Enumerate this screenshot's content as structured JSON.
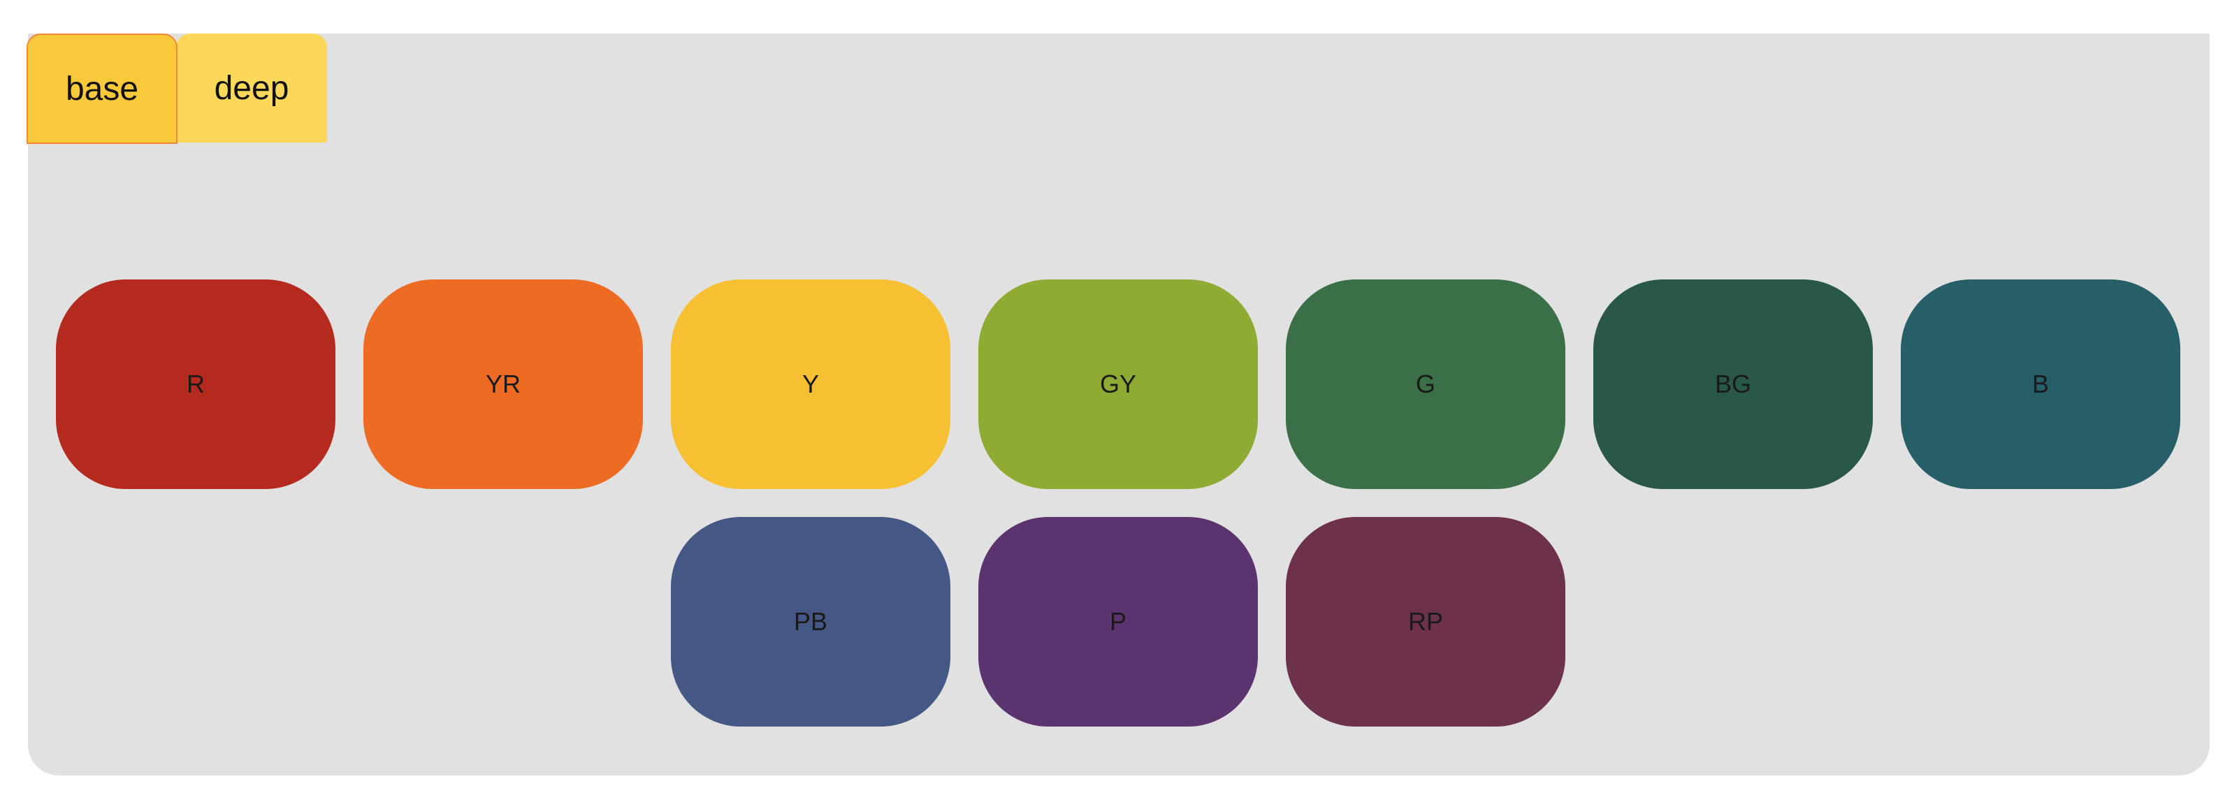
{
  "tabs": [
    {
      "label": "base",
      "selected": true
    },
    {
      "label": "deep",
      "selected": false
    }
  ],
  "swatches": [
    {
      "label": "R",
      "color": "#b52a1f"
    },
    {
      "label": "YR",
      "color": "#ee6b24"
    },
    {
      "label": "Y",
      "color": "#f6c032"
    },
    {
      "label": "GY",
      "color": "#8fab33"
    },
    {
      "label": "G",
      "color": "#3b6f48"
    },
    {
      "label": "BG",
      "color": "#29584a"
    },
    {
      "label": "B",
      "color": "#275f69"
    },
    {
      "label": "PB",
      "color": "#455785"
    },
    {
      "label": "P",
      "color": "#5b336e"
    },
    {
      "label": "RP",
      "color": "#6e314c"
    }
  ],
  "colors": {
    "panel": "#e1e1e1",
    "tab_selected": "#f8c93a",
    "tab_selected_border": "#f0883a",
    "tab_unselected": "#fbd75a"
  }
}
